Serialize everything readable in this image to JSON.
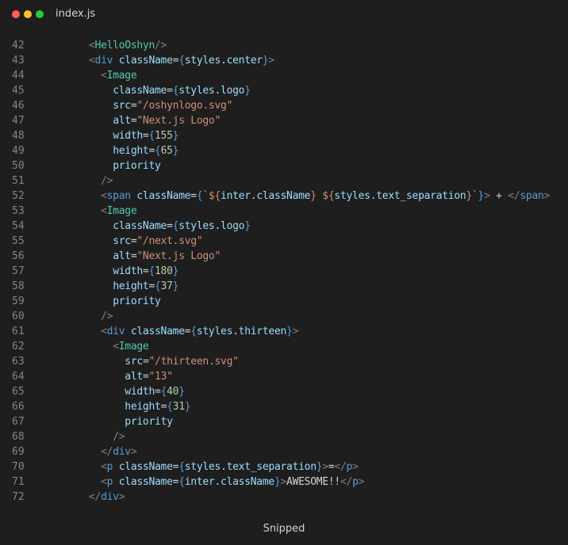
{
  "window": {
    "filename": "index.js",
    "dots": [
      {
        "name": "close",
        "color": "#ff5f56"
      },
      {
        "name": "minimize",
        "color": "#ffbd2e"
      },
      {
        "name": "maximize",
        "color": "#27c93f"
      }
    ]
  },
  "footer": {
    "label": "Snipped"
  },
  "colors": {
    "punct": "#808080",
    "tag": "#569cd6",
    "component": "#4ec9b0",
    "attr": "#9cdcfe",
    "string": "#ce9178",
    "number": "#b5cea8",
    "text": "#d4d4d4",
    "background": "#1e1e1e"
  },
  "lines": [
    {
      "n": 42,
      "indent": 4,
      "tokens": [
        [
          "punct",
          "<"
        ],
        [
          "comp",
          "HelloOshyn"
        ],
        [
          "punct",
          "/>"
        ]
      ]
    },
    {
      "n": 43,
      "indent": 4,
      "tokens": [
        [
          "punct",
          "<"
        ],
        [
          "tag",
          "div"
        ],
        [
          "text",
          " "
        ],
        [
          "attr",
          "className"
        ],
        [
          "op",
          "="
        ],
        [
          "brace",
          "{"
        ],
        [
          "attr",
          "styles"
        ],
        [
          "op",
          "."
        ],
        [
          "attr",
          "center"
        ],
        [
          "brace",
          "}"
        ],
        [
          "punct",
          ">"
        ]
      ]
    },
    {
      "n": 44,
      "indent": 6,
      "tokens": [
        [
          "punct",
          "<"
        ],
        [
          "comp",
          "Image"
        ]
      ]
    },
    {
      "n": 45,
      "indent": 8,
      "tokens": [
        [
          "attr",
          "className"
        ],
        [
          "op",
          "="
        ],
        [
          "brace",
          "{"
        ],
        [
          "attr",
          "styles"
        ],
        [
          "op",
          "."
        ],
        [
          "attr",
          "logo"
        ],
        [
          "brace",
          "}"
        ]
      ]
    },
    {
      "n": 46,
      "indent": 8,
      "tokens": [
        [
          "attr",
          "src"
        ],
        [
          "op",
          "="
        ],
        [
          "str",
          "\"/oshynlogo.svg\""
        ]
      ]
    },
    {
      "n": 47,
      "indent": 8,
      "tokens": [
        [
          "attr",
          "alt"
        ],
        [
          "op",
          "="
        ],
        [
          "str",
          "\"Next.js Logo\""
        ]
      ]
    },
    {
      "n": 48,
      "indent": 8,
      "tokens": [
        [
          "attr",
          "width"
        ],
        [
          "op",
          "="
        ],
        [
          "brace",
          "{"
        ],
        [
          "num",
          "155"
        ],
        [
          "brace",
          "}"
        ]
      ]
    },
    {
      "n": 49,
      "indent": 8,
      "tokens": [
        [
          "attr",
          "height"
        ],
        [
          "op",
          "="
        ],
        [
          "brace",
          "{"
        ],
        [
          "num",
          "65"
        ],
        [
          "brace",
          "}"
        ]
      ]
    },
    {
      "n": 50,
      "indent": 8,
      "tokens": [
        [
          "attr",
          "priority"
        ]
      ]
    },
    {
      "n": 51,
      "indent": 6,
      "tokens": [
        [
          "punct",
          "/>"
        ]
      ]
    },
    {
      "n": 52,
      "indent": 6,
      "tokens": [
        [
          "punct",
          "<"
        ],
        [
          "tag",
          "span"
        ],
        [
          "text",
          " "
        ],
        [
          "attr",
          "className"
        ],
        [
          "op",
          "="
        ],
        [
          "brace",
          "{"
        ],
        [
          "str",
          "`${"
        ],
        [
          "attr",
          "inter"
        ],
        [
          "op",
          "."
        ],
        [
          "attr",
          "className"
        ],
        [
          "str",
          "} ${"
        ],
        [
          "attr",
          "styles"
        ],
        [
          "op",
          "."
        ],
        [
          "attr",
          "text_separation"
        ],
        [
          "str",
          "}`"
        ],
        [
          "brace",
          "}"
        ],
        [
          "punct",
          ">"
        ],
        [
          "text",
          " + "
        ],
        [
          "punct",
          "</"
        ],
        [
          "tag",
          "span"
        ],
        [
          "punct",
          ">"
        ]
      ]
    },
    {
      "n": 53,
      "indent": 6,
      "tokens": [
        [
          "punct",
          "<"
        ],
        [
          "comp",
          "Image"
        ]
      ]
    },
    {
      "n": 54,
      "indent": 8,
      "tokens": [
        [
          "attr",
          "className"
        ],
        [
          "op",
          "="
        ],
        [
          "brace",
          "{"
        ],
        [
          "attr",
          "styles"
        ],
        [
          "op",
          "."
        ],
        [
          "attr",
          "logo"
        ],
        [
          "brace",
          "}"
        ]
      ]
    },
    {
      "n": 55,
      "indent": 8,
      "tokens": [
        [
          "attr",
          "src"
        ],
        [
          "op",
          "="
        ],
        [
          "str",
          "\"/next.svg\""
        ]
      ]
    },
    {
      "n": 56,
      "indent": 8,
      "tokens": [
        [
          "attr",
          "alt"
        ],
        [
          "op",
          "="
        ],
        [
          "str",
          "\"Next.js Logo\""
        ]
      ]
    },
    {
      "n": 57,
      "indent": 8,
      "tokens": [
        [
          "attr",
          "width"
        ],
        [
          "op",
          "="
        ],
        [
          "brace",
          "{"
        ],
        [
          "num",
          "180"
        ],
        [
          "brace",
          "}"
        ]
      ]
    },
    {
      "n": 58,
      "indent": 8,
      "tokens": [
        [
          "attr",
          "height"
        ],
        [
          "op",
          "="
        ],
        [
          "brace",
          "{"
        ],
        [
          "num",
          "37"
        ],
        [
          "brace",
          "}"
        ]
      ]
    },
    {
      "n": 59,
      "indent": 8,
      "tokens": [
        [
          "attr",
          "priority"
        ]
      ]
    },
    {
      "n": 60,
      "indent": 6,
      "tokens": [
        [
          "punct",
          "/>"
        ]
      ]
    },
    {
      "n": 61,
      "indent": 6,
      "tokens": [
        [
          "punct",
          "<"
        ],
        [
          "tag",
          "div"
        ],
        [
          "text",
          " "
        ],
        [
          "attr",
          "className"
        ],
        [
          "op",
          "="
        ],
        [
          "brace",
          "{"
        ],
        [
          "attr",
          "styles"
        ],
        [
          "op",
          "."
        ],
        [
          "attr",
          "thirteen"
        ],
        [
          "brace",
          "}"
        ],
        [
          "punct",
          ">"
        ]
      ]
    },
    {
      "n": 62,
      "indent": 8,
      "tokens": [
        [
          "punct",
          "<"
        ],
        [
          "comp",
          "Image"
        ]
      ]
    },
    {
      "n": 63,
      "indent": 10,
      "tokens": [
        [
          "attr",
          "src"
        ],
        [
          "op",
          "="
        ],
        [
          "str",
          "\"/thirteen.svg\""
        ]
      ]
    },
    {
      "n": 64,
      "indent": 10,
      "tokens": [
        [
          "attr",
          "alt"
        ],
        [
          "op",
          "="
        ],
        [
          "str",
          "\"13\""
        ]
      ]
    },
    {
      "n": 65,
      "indent": 10,
      "tokens": [
        [
          "attr",
          "width"
        ],
        [
          "op",
          "="
        ],
        [
          "brace",
          "{"
        ],
        [
          "num",
          "40"
        ],
        [
          "brace",
          "}"
        ]
      ]
    },
    {
      "n": 66,
      "indent": 10,
      "tokens": [
        [
          "attr",
          "height"
        ],
        [
          "op",
          "="
        ],
        [
          "brace",
          "{"
        ],
        [
          "num",
          "31"
        ],
        [
          "brace",
          "}"
        ]
      ]
    },
    {
      "n": 67,
      "indent": 10,
      "tokens": [
        [
          "attr",
          "priority"
        ]
      ]
    },
    {
      "n": 68,
      "indent": 8,
      "tokens": [
        [
          "punct",
          "/>"
        ]
      ]
    },
    {
      "n": 69,
      "indent": 6,
      "tokens": [
        [
          "punct",
          "</"
        ],
        [
          "tag",
          "div"
        ],
        [
          "punct",
          ">"
        ]
      ]
    },
    {
      "n": 70,
      "indent": 6,
      "tokens": [
        [
          "punct",
          "<"
        ],
        [
          "tag",
          "p"
        ],
        [
          "text",
          " "
        ],
        [
          "attr",
          "className"
        ],
        [
          "op",
          "="
        ],
        [
          "brace",
          "{"
        ],
        [
          "attr",
          "styles"
        ],
        [
          "op",
          "."
        ],
        [
          "attr",
          "text_separation"
        ],
        [
          "brace",
          "}"
        ],
        [
          "punct",
          ">"
        ],
        [
          "text",
          "="
        ],
        [
          "punct",
          "</"
        ],
        [
          "tag",
          "p"
        ],
        [
          "punct",
          ">"
        ]
      ]
    },
    {
      "n": 71,
      "indent": 6,
      "tokens": [
        [
          "punct",
          "<"
        ],
        [
          "tag",
          "p"
        ],
        [
          "text",
          " "
        ],
        [
          "attr",
          "className"
        ],
        [
          "op",
          "="
        ],
        [
          "brace",
          "{"
        ],
        [
          "attr",
          "inter"
        ],
        [
          "op",
          "."
        ],
        [
          "attr",
          "className"
        ],
        [
          "brace",
          "}"
        ],
        [
          "punct",
          ">"
        ],
        [
          "text",
          "AWESOME!!"
        ],
        [
          "punct",
          "</"
        ],
        [
          "tag",
          "p"
        ],
        [
          "punct",
          ">"
        ]
      ]
    },
    {
      "n": 72,
      "indent": 4,
      "tokens": [
        [
          "punct",
          "</"
        ],
        [
          "tag",
          "div"
        ],
        [
          "punct",
          ">"
        ]
      ]
    }
  ]
}
